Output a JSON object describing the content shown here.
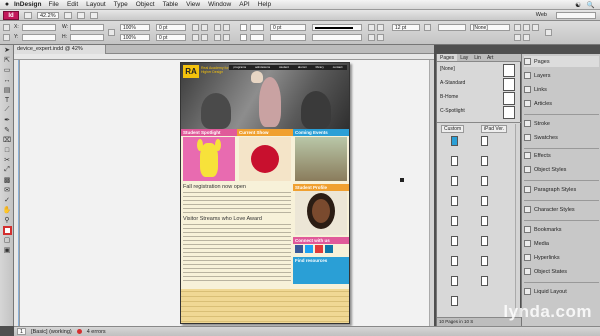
{
  "menubar": {
    "apple": "",
    "app": "InDesign",
    "items": [
      "File",
      "Edit",
      "Layout",
      "Type",
      "Object",
      "Table",
      "View",
      "Window",
      "API",
      "Help"
    ]
  },
  "appbar": {
    "logo": "Id",
    "zoom": "42.2%",
    "workspace": "Web"
  },
  "control": {
    "x_label": "X:",
    "y_label": "Y:",
    "w_label": "W:",
    "h_label": "H:",
    "pt_value": "0 pt",
    "percent1": "100%",
    "stroke_value": "12 pt",
    "frame_label": "[None]"
  },
  "document": {
    "tab": "device_expert.indd @ 42%"
  },
  "status": {
    "page": "1",
    "profile": "[Basic] (working)",
    "errors": "4 errors"
  },
  "webpage": {
    "logo": "RA",
    "logo_sub": "Real Academy for Higher Design",
    "nav": [
      "programs",
      "admissions",
      "student",
      "alumni",
      "library",
      "contact"
    ],
    "sec1": "Student Spotlight",
    "sec2": "Current Show",
    "sec3": "Coming Events",
    "sec4": "Student Profile",
    "sec5": "Connect with us",
    "sec6": "Find resources",
    "reg_title": "Fall registration now open",
    "visitor_title": "Visitor Streams who Love Award"
  },
  "pages_panel": {
    "tabs": [
      "Pages",
      "Lay",
      "Lin",
      "Art"
    ],
    "masters": [
      "[None]",
      "A-Standard",
      "B-Home",
      "C-Spotlight"
    ],
    "custom_label": "Custom",
    "ipad_label": "iPad Ver.",
    "footer": "10 Pages in 10 S"
  },
  "side_panel": {
    "groups": [
      [
        "Pages",
        "Layers",
        "Links",
        "Articles"
      ],
      [
        "Stroke",
        "Swatches"
      ],
      [
        "Effects",
        "Object Styles"
      ],
      [
        "Paragraph Styles"
      ],
      [
        "Character Styles"
      ],
      [
        "Bookmarks",
        "Media",
        "Hyperlinks",
        "Object States"
      ],
      [
        "Liquid Layout"
      ]
    ]
  },
  "watermark": "lynda.com",
  "colors": {
    "indesign_pink": "#c2185b",
    "section_blue": "#2a9fd6",
    "section_pink": "#e05a9a",
    "section_orange": "#f0a030",
    "logo_yellow": "#f4c20d"
  }
}
